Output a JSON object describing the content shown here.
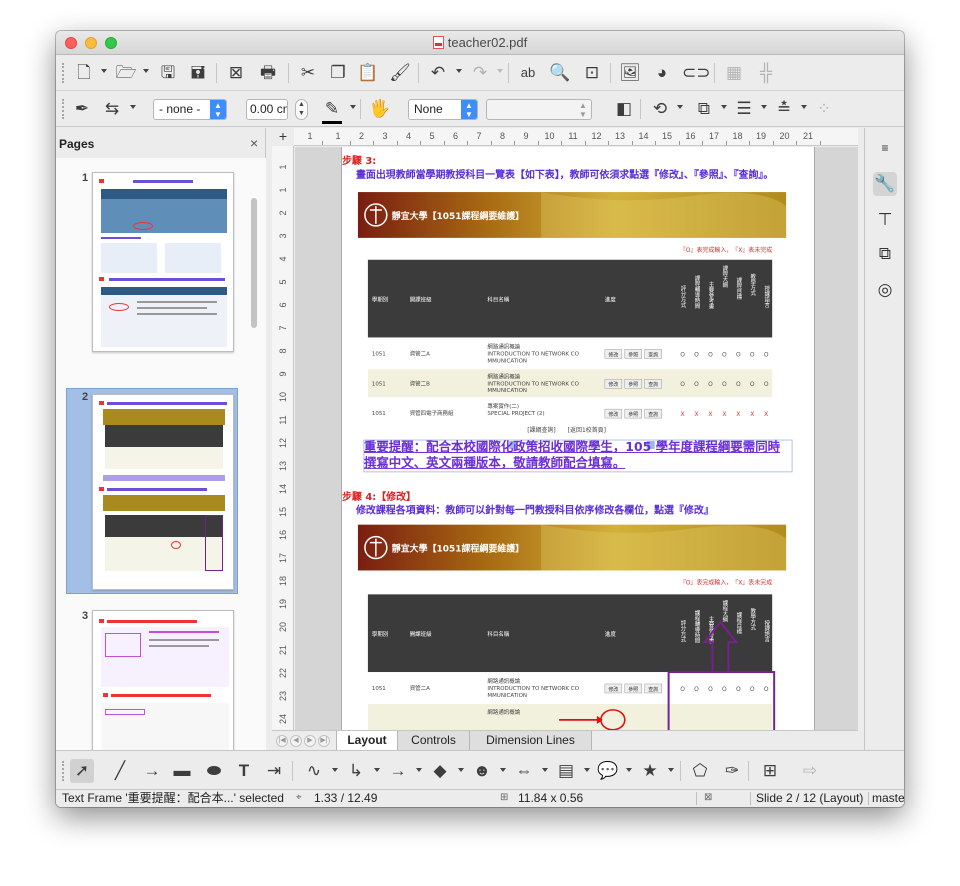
{
  "window": {
    "title": "teacher02.pdf"
  },
  "toolbar_standard": {
    "tools": [
      "new-document-icon",
      "open-folder-icon",
      "save-icon",
      "save-as-icon",
      "export-pdf-icon",
      "print-icon",
      "cut-icon",
      "copy-icon",
      "paste-icon",
      "clone-formatting-icon",
      "undo-icon",
      "redo-icon",
      "spelling-icon",
      "zoom-pan-icon",
      "display-grid-icon",
      "image-icon",
      "chart-icon",
      "hyperlink-icon",
      "helplines-icon",
      "snap-icon"
    ]
  },
  "toolbar_formatting": {
    "area_style": "- none -",
    "line_width": "0.00 cm",
    "area_fill": "None",
    "area_color": "",
    "colors": {
      "line": "#000000"
    }
  },
  "pages_panel": {
    "title": "Pages",
    "close": "×",
    "pages": [
      {
        "number": "1",
        "selected": false
      },
      {
        "number": "2",
        "selected": true
      },
      {
        "number": "3",
        "selected": false
      }
    ]
  },
  "ruler": {
    "h_labels": [
      "1",
      "1",
      "2",
      "3",
      "4",
      "5",
      "6",
      "7",
      "8",
      "9",
      "10",
      "11",
      "12",
      "13",
      "14",
      "15",
      "16",
      "17",
      "18",
      "19",
      "20",
      "21"
    ],
    "v_labels": [
      "1",
      "1",
      "2",
      "3",
      "4",
      "5",
      "6",
      "7",
      "8",
      "9",
      "10",
      "11",
      "12",
      "13",
      "14",
      "15",
      "16",
      "17",
      "18",
      "19",
      "20",
      "21",
      "22",
      "23",
      "24"
    ]
  },
  "document": {
    "step3_label": "步驟 3:",
    "step3_text": "畫面出現教師當學期教授科目一覽表【如下表】，教師可依須求點選『修改』、『參照』、『查詢』。",
    "banner_title": "靜宜大學【1051課程綱要維護】",
    "legend": "『O』表完成輸入，『X』表未完成",
    "table_headers": [
      "學期別",
      "開課班級",
      "科目名稱",
      "進度",
      "評分方式",
      "課程輔導時間",
      "主要參考書",
      "課程大綱",
      "課程目標",
      "教學方式",
      "授課語言"
    ],
    "rows": [
      {
        "term": "1051",
        "class": "資管二A",
        "course": "網路通訊概論\nINTRODUCTION TO NETWORK COMMUNICATION",
        "btn1": "修改",
        "btn2": "參照",
        "btn3": "查詢",
        "status": "O",
        "statuses": [
          "O",
          "O",
          "O",
          "O",
          "O",
          "O",
          "O"
        ]
      },
      {
        "term": "1051",
        "class": "資管二B",
        "course": "網路通訊概論\nINTRODUCTION TO NETWORK COMMUNICATION",
        "btn1": "修改",
        "btn2": "參照",
        "btn3": "查詢",
        "status": "O",
        "statuses": [
          "O",
          "O",
          "O",
          "O",
          "O",
          "O",
          "O"
        ]
      },
      {
        "term": "1051",
        "class": "資管四電子商務組",
        "course": "專案實作(二)\nSPECIAL PROJECT (2)",
        "btn1": "修改",
        "btn2": "參照",
        "btn3": "查詢",
        "status": "X",
        "statuses": [
          "X",
          "X",
          "X",
          "X",
          "X",
          "X",
          "X"
        ]
      }
    ],
    "links": "[課綱查詢]　　[返回1校首頁]",
    "notice_text": "重要提醒：配合本校國際化政策招收國際學生，105 學年度課程綱要需同時撰寫中文、英文兩種版本，敬請教師配合填寫。",
    "step4_label": "步驟 4:【修改】",
    "step4_text": "修改課程各項資料：教師可以針對每一門教授科目依序修改各欄位，點選『修改』",
    "row2": {
      "term": "1051",
      "class": "資管二A",
      "course": "網路通訊概論\nINTRODUCTION TO NETWORK COMMUNICATION",
      "btn1": "修改",
      "btn2": "參照",
      "btn3": "查詢",
      "statuses": [
        "O",
        "O",
        "O",
        "O",
        "O",
        "O",
        "O"
      ]
    },
    "row3_partial": "網路通訊概論"
  },
  "view_tabs": [
    "Layout",
    "Controls",
    "Dimension Lines"
  ],
  "sidebar": {
    "tools": [
      "sidebar-menu-icon",
      "properties-icon",
      "styles-icon",
      "gallery-icon",
      "navigator-icon"
    ]
  },
  "toolbar_drawing": {
    "tools": [
      "select-icon",
      "line-icon",
      "arrow-icon",
      "rectangle-icon",
      "ellipse-icon",
      "text-icon",
      "vertical-text-icon",
      "curve-icon",
      "connector-icon",
      "line-arrow-icon",
      "diamond-icon",
      "smiley-icon",
      "double-arrow-icon",
      "flowchart-icon",
      "callout-icon",
      "star-icon",
      "points-icon",
      "glue-icon",
      "fontwork-icon",
      "toggle-extrusion-icon"
    ]
  },
  "status": {
    "selection": "Text Frame '重要提醒：配合本...' selected",
    "position": "1.33 / 12.49",
    "size": "11.84 x 0.56",
    "slide": "Slide 2 / 12 (Layout)",
    "master": "maste"
  }
}
